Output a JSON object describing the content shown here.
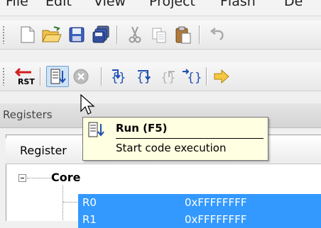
{
  "menu": [
    "File",
    "Edit",
    "View",
    "Project",
    "Flash",
    "De"
  ],
  "toolbar1": {
    "buttons": [
      "new-file-icon",
      "open-folder-icon",
      "save-icon",
      "save-all-icon",
      "cut-icon",
      "copy-icon",
      "paste-icon",
      "undo-icon"
    ]
  },
  "toolbar2": {
    "buttons": [
      "reset-icon",
      "run-icon",
      "stop-icon",
      "step-into-icon",
      "step-over-icon",
      "step-out-icon",
      "run-to-cursor-icon",
      "show-next-statement-icon"
    ],
    "rst_label": "RST"
  },
  "panel": {
    "title": "Registers",
    "column_register": "Register"
  },
  "tree": {
    "group": "Core",
    "rows": [
      {
        "name": "R0",
        "value": "0xFFFFFFFF"
      },
      {
        "name": "R1",
        "value": "0xFFFFFFFF"
      }
    ]
  },
  "tooltip": {
    "title": "Run (F5)",
    "description": "Start code execution"
  },
  "colors": {
    "selection": "#3399ff",
    "tooltip_bg": "#ffffe1"
  }
}
